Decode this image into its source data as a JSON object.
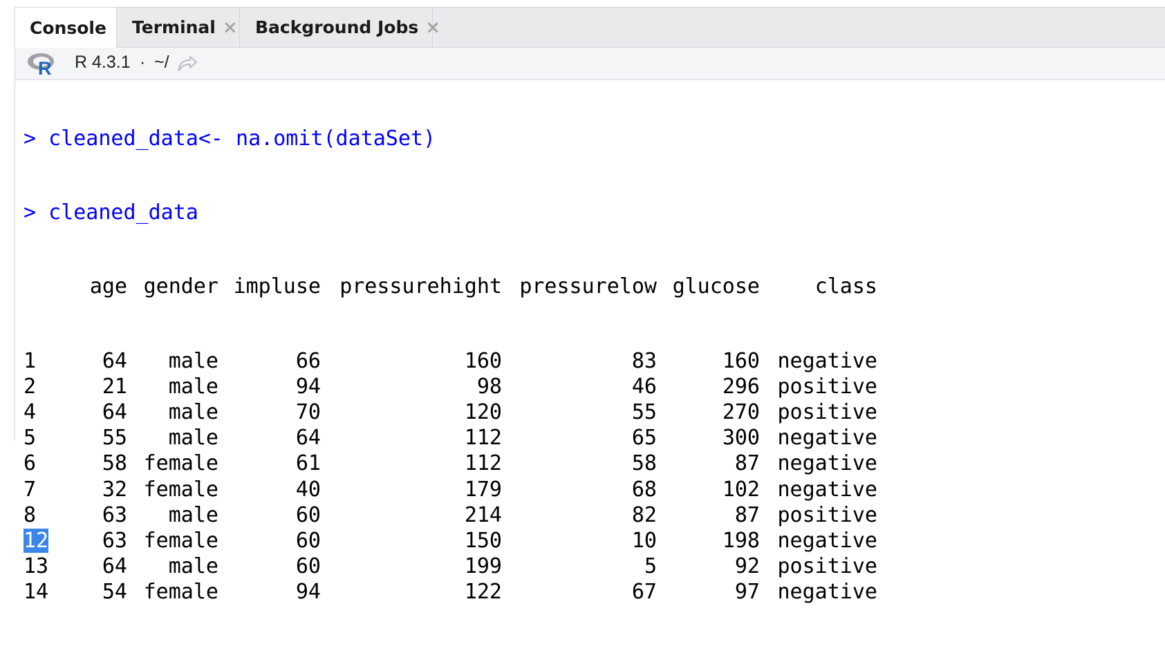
{
  "tabs": [
    {
      "label": "Console",
      "active": true,
      "closable": false
    },
    {
      "label": "Terminal",
      "active": false,
      "closable": true
    },
    {
      "label": "Background Jobs",
      "active": false,
      "closable": true
    }
  ],
  "toolbar": {
    "r_version": "R 4.3.1",
    "separator": "·",
    "path": "~/"
  },
  "console": {
    "commands": [
      {
        "prompt": ">",
        "text": "cleaned_data<- na.omit(dataSet)"
      },
      {
        "prompt": ">",
        "text": "cleaned_data"
      }
    ],
    "columns": [
      "age",
      "gender",
      "impluse",
      "pressurehight",
      "pressurelow",
      "glucose",
      "class"
    ],
    "rows": [
      {
        "id": "1",
        "cells": [
          "64",
          "male",
          "66",
          "160",
          "83",
          "160",
          "negative"
        ]
      },
      {
        "id": "2",
        "cells": [
          "21",
          "male",
          "94",
          "98",
          "46",
          "296",
          "positive"
        ]
      },
      {
        "id": "4",
        "cells": [
          "64",
          "male",
          "70",
          "120",
          "55",
          "270",
          "positive"
        ]
      },
      {
        "id": "5",
        "cells": [
          "55",
          "male",
          "64",
          "112",
          "65",
          "300",
          "negative"
        ]
      },
      {
        "id": "6",
        "cells": [
          "58",
          "female",
          "61",
          "112",
          "58",
          "87",
          "negative"
        ]
      },
      {
        "id": "7",
        "cells": [
          "32",
          "female",
          "40",
          "179",
          "68",
          "102",
          "negative"
        ]
      },
      {
        "id": "8",
        "cells": [
          "63",
          "male",
          "60",
          "214",
          "82",
          "87",
          "positive"
        ]
      },
      {
        "id": "12",
        "cells": [
          "63",
          "female",
          "60",
          "150",
          "10",
          "198",
          "negative"
        ],
        "selected": true
      },
      {
        "id": "13",
        "cells": [
          "64",
          "male",
          "60",
          "199",
          "5",
          "92",
          "positive"
        ]
      },
      {
        "id": "14",
        "cells": [
          "54",
          "female",
          "94",
          "122",
          "67",
          "97",
          "negative"
        ]
      }
    ],
    "highlight_color": "#3b86e8",
    "command_color": "#0000ff"
  }
}
